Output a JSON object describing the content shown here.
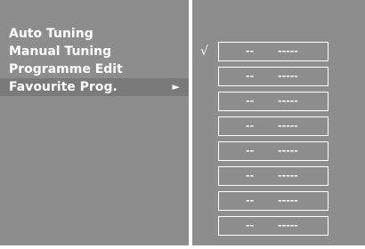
{
  "menu": {
    "items": [
      {
        "label": "Auto Tuning"
      },
      {
        "label": "Manual Tuning"
      },
      {
        "label": "Programme Edit"
      },
      {
        "label": "Favourite Prog.",
        "arrow": "►"
      }
    ]
  },
  "favourites": {
    "check_mark": "√",
    "slots": [
      {
        "number": "--",
        "name": "-----"
      },
      {
        "number": "--",
        "name": "-----"
      },
      {
        "number": "--",
        "name": "-----"
      },
      {
        "number": "--",
        "name": "-----"
      },
      {
        "number": "--",
        "name": "-----"
      },
      {
        "number": "--",
        "name": "-----"
      },
      {
        "number": "--",
        "name": "-----"
      },
      {
        "number": "--",
        "name": "-----"
      }
    ]
  },
  "colors": {
    "panel": "#8d8d8d",
    "highlight": "#7a7a7a",
    "text": "#ffffff"
  }
}
